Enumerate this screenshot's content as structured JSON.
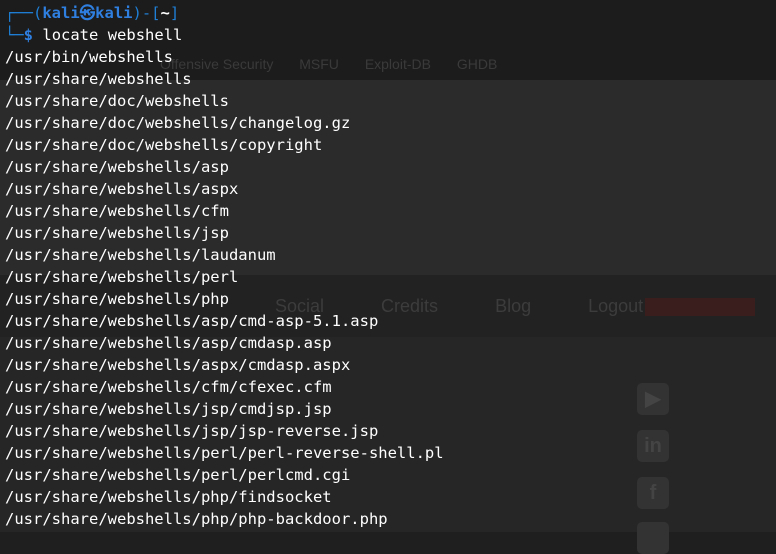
{
  "prompt": {
    "user": "kali",
    "separator": "㉿",
    "host": "kali",
    "cwd": "~",
    "symbol": "$"
  },
  "command": {
    "program": "locate",
    "argument": "webshell"
  },
  "output": [
    "/usr/bin/webshells",
    "/usr/share/webshells",
    "/usr/share/doc/webshells",
    "/usr/share/doc/webshells/changelog.gz",
    "/usr/share/doc/webshells/copyright",
    "/usr/share/webshells/asp",
    "/usr/share/webshells/aspx",
    "/usr/share/webshells/cfm",
    "/usr/share/webshells/jsp",
    "/usr/share/webshells/laudanum",
    "/usr/share/webshells/perl",
    "/usr/share/webshells/php",
    "/usr/share/webshells/asp/cmd-asp-5.1.asp",
    "/usr/share/webshells/asp/cmdasp.asp",
    "/usr/share/webshells/aspx/cmdasp.aspx",
    "/usr/share/webshells/cfm/cfexec.cfm",
    "/usr/share/webshells/jsp/cmdjsp.jsp",
    "/usr/share/webshells/jsp/jsp-reverse.jsp",
    "/usr/share/webshells/perl/perl-reverse-shell.pl",
    "/usr/share/webshells/perl/perlcmd.cgi",
    "/usr/share/webshells/php/findsocket",
    "/usr/share/webshells/php/php-backdoor.php"
  ],
  "background_page": {
    "bookmarks": [
      "Offensive Security",
      "MSFU",
      "Exploit-DB",
      "GHDB"
    ],
    "nav": [
      "Social",
      "Credits",
      "Blog",
      "Logout"
    ],
    "social_icons": [
      "youtube-icon",
      "linkedin-icon",
      "facebook-icon"
    ]
  },
  "colors": {
    "terminal_bg": "#1f1f1f",
    "prompt_blue": "#2f7fe0",
    "text": "#ffffff"
  }
}
